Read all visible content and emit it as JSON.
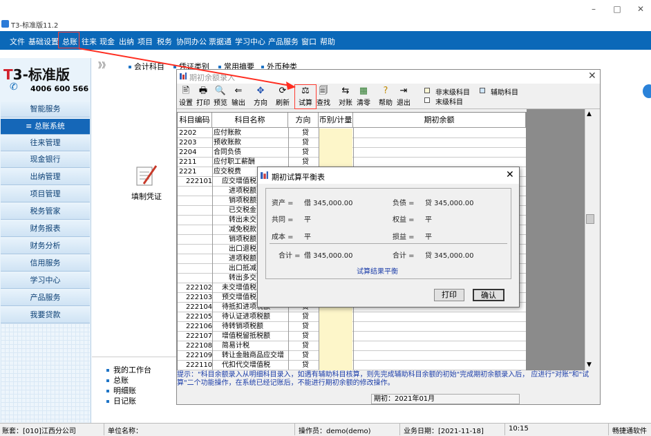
{
  "app": {
    "title": "T3-标准版11.2"
  },
  "window_controls": {
    "minimize": "–",
    "maximize": "□",
    "close": "✕"
  },
  "menu": [
    "文件",
    "基础设置",
    "总账",
    "往来",
    "现金",
    "出纳",
    "项目",
    "税务",
    "协同办公",
    "票据通",
    "学习中心",
    "产品服务",
    "窗口",
    "帮助"
  ],
  "brand": {
    "t": "T",
    "rest": "3-标准版",
    "phone": "4006 600 566"
  },
  "sidebar": [
    "智能服务",
    "总账系统",
    "往来管理",
    "现金银行",
    "出纳管理",
    "项目管理",
    "税务管家",
    "财务报表",
    "财务分析",
    "信用服务",
    "学习中心",
    "产品服务",
    "我要贷款"
  ],
  "module_tabs": {
    "expand": "》》",
    "items": [
      "会计科目",
      "凭证类别",
      "常用摘要",
      "外币种类"
    ]
  },
  "voucher": {
    "label": "填制凭证"
  },
  "quick_list": [
    "我的工作台",
    "总账",
    "明细账",
    "日记账"
  ],
  "main_dialog": {
    "title": "期初余额录入",
    "toolbar": [
      {
        "icon": "print-setup-icon",
        "glyph": "🖹",
        "label": "设置"
      },
      {
        "icon": "print-icon",
        "glyph": "🖶",
        "label": "打印"
      },
      {
        "icon": "preview-icon",
        "glyph": "🔍",
        "label": "预览"
      },
      {
        "icon": "export-icon",
        "glyph": "⇐",
        "label": "输出"
      },
      {
        "icon": "direction-icon",
        "glyph": "✥",
        "label": "方向"
      },
      {
        "icon": "refresh-icon",
        "glyph": "⟳",
        "label": "刷新"
      },
      {
        "icon": "balance-scale-icon",
        "glyph": "⚖",
        "label": "试算"
      },
      {
        "icon": "find-icon",
        "glyph": "🗐",
        "label": "查找"
      },
      {
        "icon": "reconcile-icon",
        "glyph": "⇆",
        "label": "对账"
      },
      {
        "icon": "clear-icon",
        "glyph": "▦",
        "label": "清零"
      },
      {
        "icon": "help-icon",
        "glyph": "?",
        "label": "帮助"
      },
      {
        "icon": "exit-icon",
        "glyph": "⇥",
        "label": "退出"
      }
    ],
    "legend": {
      "non_leaf": "非末级科目",
      "aux": "辅助科目",
      "leaf": "末级科目"
    },
    "legend_colors": {
      "non_leaf": "#fff8d6",
      "aux": "#cfe6ff",
      "leaf": "#ffffff"
    },
    "columns": [
      "科目编码",
      "科目名称",
      "方向",
      "币别/计量",
      "期初余额"
    ],
    "rows": [
      {
        "code": "2202",
        "name": "应付账款",
        "dir": "贷"
      },
      {
        "code": "2203",
        "name": "预收账款",
        "dir": "贷"
      },
      {
        "code": "2204",
        "name": "合同负债",
        "dir": "贷"
      },
      {
        "code": "2211",
        "name": "应付职工薪酬",
        "dir": "贷"
      },
      {
        "code": "2221",
        "name": "应交税费",
        "dir": "贷"
      },
      {
        "code": "222101",
        "name": "应交增值税",
        "dir": ""
      },
      {
        "code": "",
        "name": "进项税额",
        "dir": ""
      },
      {
        "code": "",
        "name": "销项税额抵",
        "dir": ""
      },
      {
        "code": "",
        "name": "已交税金",
        "dir": ""
      },
      {
        "code": "",
        "name": "转出未交",
        "dir": ""
      },
      {
        "code": "",
        "name": "减免税款",
        "dir": ""
      },
      {
        "code": "",
        "name": "销项税额",
        "dir": ""
      },
      {
        "code": "",
        "name": "出口退税",
        "dir": ""
      },
      {
        "code": "",
        "name": "进项税额",
        "dir": ""
      },
      {
        "code": "",
        "name": "出口抵减",
        "dir": ""
      },
      {
        "code": "",
        "name": "转出多交",
        "dir": ""
      },
      {
        "code": "222102",
        "name": "未交增值税",
        "dir": ""
      },
      {
        "code": "222103",
        "name": "预交增值税",
        "dir": ""
      },
      {
        "code": "222104",
        "name": "待抵扣进项税额",
        "dir": "贷"
      },
      {
        "code": "222105",
        "name": "待认证进项税额",
        "dir": "贷"
      },
      {
        "code": "222106",
        "name": "待转销项税额",
        "dir": "贷"
      },
      {
        "code": "222107",
        "name": "增值税留抵税额",
        "dir": "贷"
      },
      {
        "code": "222108",
        "name": "简易计税",
        "dir": "贷"
      },
      {
        "code": "222109",
        "name": "转让金融商品应交增",
        "dir": "贷"
      },
      {
        "code": "222110",
        "name": "代扣代交增值税",
        "dir": "贷"
      }
    ],
    "hint": "提示：\"科目余额录入从明细科目录入，如遇有辅助科目核算，则先完成辅助科目余额的初始\"完成期初余额录入后，      应进行\"对账\"和\"试算\"二个功能操作，在系统已经记账后，不能进行期初余额的修改操作。",
    "period": "期初：2021年01月"
  },
  "trial_balance": {
    "title": "期初试算平衡表",
    "assets_label": "资产 =",
    "assets_value": "借 345,000.00",
    "liab_label": "负债 =",
    "liab_value": "贷 345,000.00",
    "common_label": "共同 =",
    "common_value": "平",
    "equity_label": "权益 =",
    "equity_value": "平",
    "cost_label": "成本 =",
    "cost_value": "平",
    "pl_label": "损益 =",
    "pl_value": "平",
    "total_left_label": "合计 =",
    "total_left_value": "借 345,000.00",
    "total_right_label": "合计 =",
    "total_right_value": "贷 345,000.00",
    "result": "试算结果平衡",
    "print": "打印",
    "ok": "确认"
  },
  "statusbar": {
    "account": "账套：[010]江西分公司",
    "unit": "单位名称：",
    "operator": "操作员：demo(demo)",
    "biz_date": "业务日期：[2021-11-18]",
    "time": "10:15",
    "vendor": "畅捷通软件"
  },
  "colors": {
    "menubar": "#0b68b8",
    "highlight": "#ff3b30",
    "sidebar_active": "#1567b8"
  }
}
